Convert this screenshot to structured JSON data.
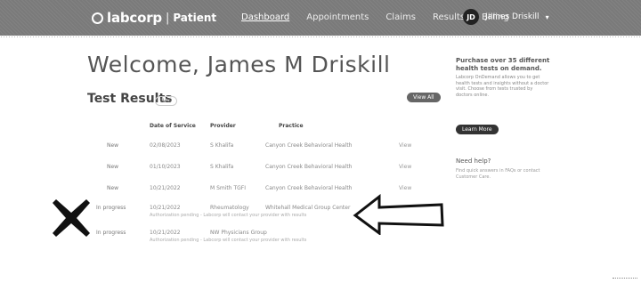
{
  "brand": {
    "name": "labcorp",
    "section": "Patient"
  },
  "nav": {
    "items": [
      "Dashboard",
      "Appointments",
      "Claims",
      "Results",
      "Billing"
    ],
    "active": "Dashboard"
  },
  "user": {
    "initials": "JD",
    "name": "James Driskill"
  },
  "page": {
    "welcome": "Welcome, James M Driskill"
  },
  "results": {
    "title": "Test Results",
    "filter_label": "New",
    "view_all_label": "View All",
    "columns": [
      "Date of Service",
      "Provider",
      "Practice"
    ],
    "rows": [
      {
        "status": "New",
        "date": "02/08/2023",
        "provider": "S Khalifa",
        "practice": "Canyon Creek Behavioral Health",
        "action": "View"
      },
      {
        "status": "New",
        "date": "01/10/2023",
        "provider": "S Khalifa",
        "practice": "Canyon Creek Behavioral Health",
        "action": "View"
      },
      {
        "status": "New",
        "date": "10/21/2022",
        "provider": "M Smith TGFI",
        "practice": "Canyon Creek Behavioral Health",
        "action": "View"
      },
      {
        "status": "In progress",
        "date": "10/21/2022",
        "provider": "Rheumatology",
        "practice": "Whitehall Medical Group Center",
        "detail": "Authorization pending - Labcorp will contact your provider with results",
        "action": ""
      },
      {
        "status": "In progress",
        "date": "10/21/2022",
        "provider": "NW Physicians Group",
        "practice": "",
        "detail": "Authorization pending - Labcorp will contact your provider with results",
        "action": ""
      }
    ]
  },
  "promo": {
    "title": "Purchase over 35 different health tests on demand.",
    "text": "Labcorp OnDemand allows you to get health tests and insights without a doctor visit. Choose from tests trusted by doctors online.",
    "button_label": "Learn More"
  },
  "help": {
    "title": "Need help?",
    "text": "Find quick answers in FAQs or contact Customer Care."
  }
}
